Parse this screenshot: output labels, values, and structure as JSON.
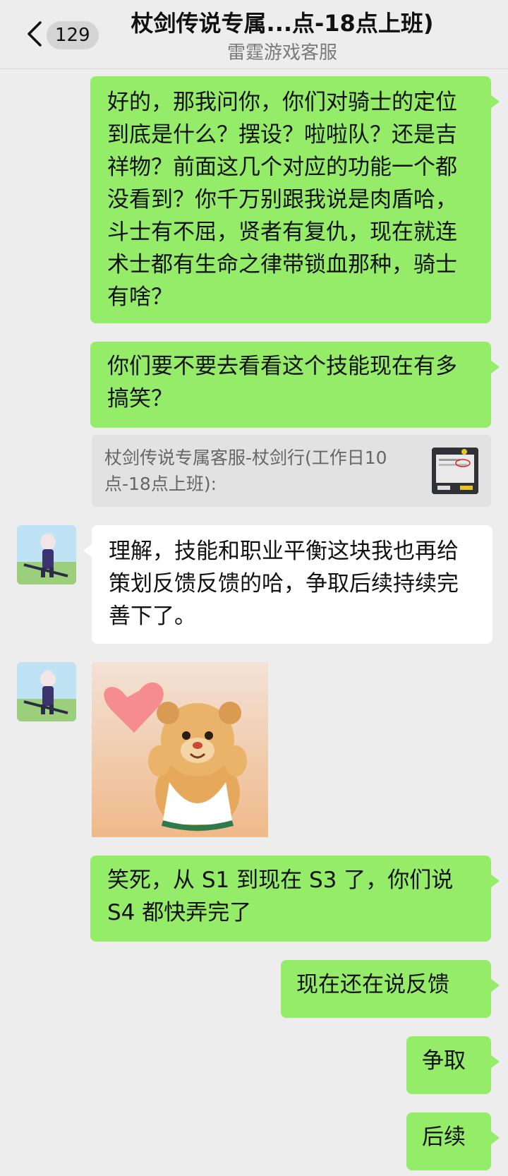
{
  "header": {
    "unread_count": "129",
    "title": "杖剑传说专属...点-18点上班)",
    "subtitle": "雷霆游戏客服"
  },
  "messages": [
    {
      "from": "me",
      "text": "好的，那我问你，你们对骑士的定位到底是什么？摆设？啦啦队？还是吉祥物？前面这几个对应的功能一个都没看到？你千万别跟我说是肉盾哈，斗士有不屈，贤者有复仇，现在就连术士都有生命之律带锁血那种，骑士有啥？"
    },
    {
      "from": "me",
      "text": "你们要不要去看看这个技能现在有多搞笑？"
    },
    {
      "from": "quote",
      "text": "杖剑传说专属客服-杖剑行(工作日10点-18点上班):"
    },
    {
      "from": "them",
      "text": "理解，技能和职业平衡这块我也再给策划反馈反馈的哈，争取后续持续完善下了。"
    },
    {
      "from": "them-sticker",
      "icon": "bear-sticker-image"
    },
    {
      "from": "me",
      "text": "笑死，从 S1 到现在 S3 了，你们说S4 都快弄完了"
    },
    {
      "from": "me",
      "text": "现在还在说反馈"
    },
    {
      "from": "me",
      "text": "争取"
    },
    {
      "from": "me",
      "text": "后续"
    }
  ],
  "colors": {
    "background": "#ededed",
    "my_bubble": "#95ec69",
    "their_bubble": "#ffffff"
  }
}
